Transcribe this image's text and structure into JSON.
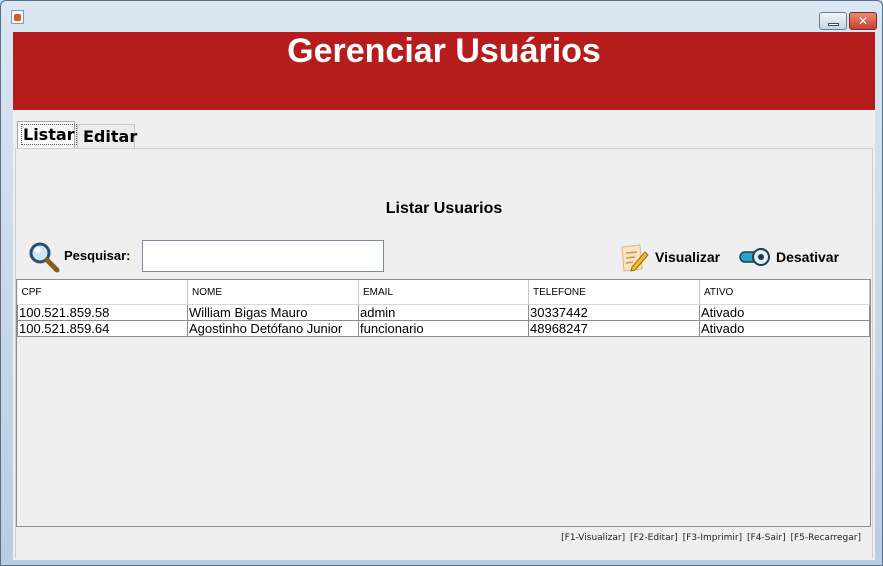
{
  "window": {
    "close_glyph": "✕"
  },
  "header": {
    "title": "Gerenciar Usuários",
    "color": "#b71c1c"
  },
  "tabs": [
    {
      "label": "Listar",
      "selected": true
    },
    {
      "label": "Editar",
      "selected": false
    }
  ],
  "main": {
    "title": "Listar Usuarios",
    "search": {
      "label": "Pesquisar:",
      "value": "",
      "icon": "magnifier-icon"
    },
    "actions": [
      {
        "label": "Visualizar",
        "icon": "notepad-pencil-icon"
      },
      {
        "label": "Desativar",
        "icon": "toggle-switch-icon"
      }
    ],
    "table": {
      "columns": [
        "CPF",
        "NOME",
        "EMAIL",
        "TELEFONE",
        "ATIVO"
      ],
      "rows": [
        [
          "100.521.859.58",
          "William Bigas Mauro",
          "admin",
          "30337442",
          "Ativado"
        ],
        [
          "100.521.859.64",
          "Agostinho Detófano Junior",
          "funcionario",
          "48968247",
          "Ativado"
        ]
      ]
    },
    "shortcuts": "[F1-Visualizar] [F2-Editar] [F3-Imprimir] [F4-Sair] [F5-Recarregar]"
  }
}
